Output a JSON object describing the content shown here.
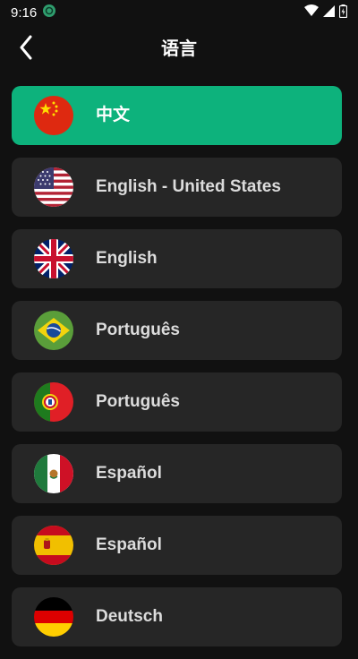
{
  "status": {
    "time": "9:16"
  },
  "header": {
    "title": "语言"
  },
  "colors": {
    "background": "#111111",
    "item": "#262626",
    "selected": "#0DB27C"
  },
  "languages": [
    {
      "label": "中文",
      "flag": "china-flag-icon",
      "selected": true
    },
    {
      "label": "English - United States",
      "flag": "usa-flag-icon",
      "selected": false
    },
    {
      "label": "English",
      "flag": "uk-flag-icon",
      "selected": false
    },
    {
      "label": "Português",
      "flag": "brazil-flag-icon",
      "selected": false
    },
    {
      "label": "Português",
      "flag": "portugal-flag-icon",
      "selected": false
    },
    {
      "label": "Español",
      "flag": "mexico-flag-icon",
      "selected": false
    },
    {
      "label": "Español",
      "flag": "spain-flag-icon",
      "selected": false
    },
    {
      "label": "Deutsch",
      "flag": "germany-flag-icon",
      "selected": false
    }
  ]
}
